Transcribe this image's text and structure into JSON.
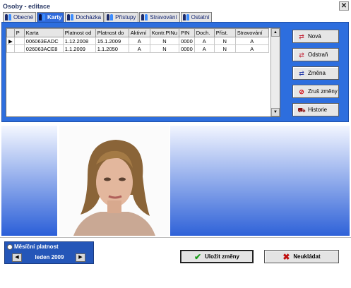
{
  "window": {
    "title": "Osoby - editace",
    "close_glyph": "✕"
  },
  "tabs": [
    {
      "label": "Obecné",
      "active": false
    },
    {
      "label": "Karty",
      "active": true
    },
    {
      "label": "Docházka",
      "active": false
    },
    {
      "label": "Přístupy",
      "active": false
    },
    {
      "label": "Stravování",
      "active": false
    },
    {
      "label": "Ostatní",
      "active": false
    }
  ],
  "grid": {
    "columns": [
      "",
      "P",
      "Karta",
      "Platnost od",
      "Platnost do",
      "Aktivní",
      "Kontr.PINu",
      "PIN",
      "Doch.",
      "Přist.",
      "Stravování"
    ],
    "rows": [
      [
        "▶",
        "",
        "006063EADC",
        "1.12.2008",
        "15.1.2009",
        "A",
        "N",
        "0000",
        "A",
        "N",
        "A"
      ],
      [
        "",
        "",
        "026063ACE8",
        "1.1.2009",
        "1.1.2050",
        "A",
        "N",
        "0000",
        "A",
        "N",
        "A"
      ]
    ]
  },
  "side_buttons": [
    {
      "label": "Nová",
      "icon": "new-card-icon"
    },
    {
      "label": "Odstraň",
      "icon": "remove-card-icon"
    },
    {
      "label": "Změna",
      "icon": "edit-card-icon"
    },
    {
      "label": "Zruš změny",
      "icon": "cancel-icon"
    },
    {
      "label": "Historie",
      "icon": "history-icon"
    }
  ],
  "month_panel": {
    "label": "Měsíční platnost",
    "value": "leden 2009"
  },
  "footer": {
    "save_label": "Uložit změny",
    "discard_label": "Neukládat"
  },
  "colors": {
    "accent": "#2d6ede",
    "active_tab": "#2f6adc"
  }
}
